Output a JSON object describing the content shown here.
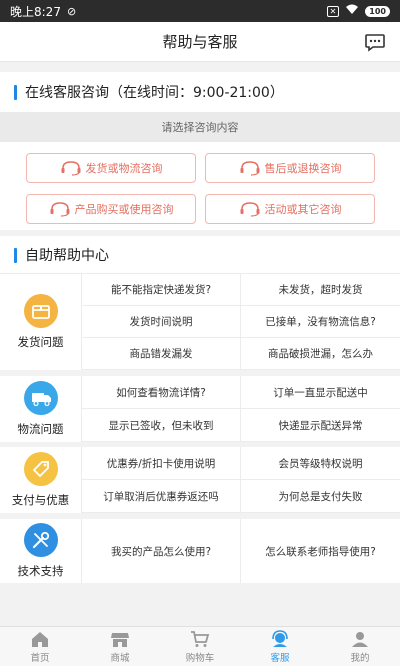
{
  "status_bar": {
    "time": "晚上8:27",
    "battery": "100"
  },
  "header": {
    "title": "帮助与客服"
  },
  "online": {
    "section_title": "在线客服咨询（在线时间：9:00-21:00）",
    "prompt": "请选择咨询内容",
    "buttons": [
      "发货或物流咨询",
      "售后或退换咨询",
      "产品购买或使用咨询",
      "活动或其它咨询"
    ]
  },
  "self_help": {
    "section_title": "自助帮助中心",
    "groups": [
      {
        "label": "发货问题",
        "icon": "box-icon",
        "questions": [
          "能不能指定快递发货?",
          "未发货，超时发货",
          "发货时间说明",
          "已接单，没有物流信息?",
          "商品错发漏发",
          "商品破损泄漏，怎么办"
        ]
      },
      {
        "label": "物流问题",
        "icon": "truck-icon",
        "questions": [
          "如何查看物流详情?",
          "订单一直显示配送中",
          "显示已签收，但未收到",
          "快递显示配送异常"
        ]
      },
      {
        "label": "支付与优惠",
        "icon": "tag-icon",
        "questions": [
          "优惠券/折扣卡使用说明",
          "会员等级特权说明",
          "订单取消后优惠券返还吗",
          "为何总是支付失败"
        ]
      },
      {
        "label": "技术支持",
        "icon": "tools-icon",
        "questions": [
          "我买的产品怎么使用?",
          "怎么联系老师指导使用?"
        ]
      }
    ]
  },
  "tabbar": {
    "items": [
      "首页",
      "商城",
      "购物车",
      "客服",
      "我的"
    ],
    "active": "客服"
  },
  "colors": {
    "accent": "#2f9be8",
    "section_bar": "#1e88e5",
    "consult_red": "#e56f60"
  }
}
